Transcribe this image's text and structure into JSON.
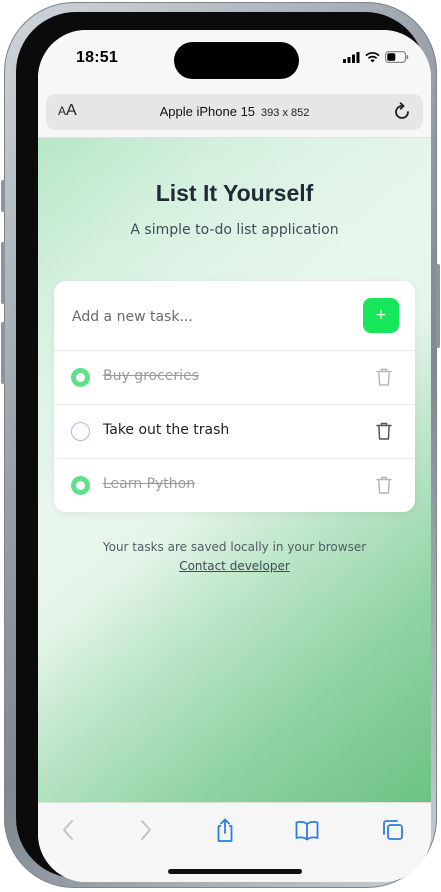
{
  "status_bar": {
    "time": "18:51"
  },
  "browser": {
    "text_size_label_small": "A",
    "text_size_label_large": "A",
    "device_name": "Apple iPhone 15",
    "viewport_size": "393 x 852"
  },
  "app": {
    "title": "List It Yourself",
    "subtitle": "A simple to-do list application",
    "input_placeholder": "Add a new task...",
    "add_button_label": "+",
    "tasks": [
      {
        "label": "Buy groceries",
        "completed": true
      },
      {
        "label": "Take out the trash",
        "completed": false
      },
      {
        "label": "Learn Python",
        "completed": true
      }
    ],
    "footer_note": "Your tasks are saved locally in your browser",
    "footer_link": "Contact developer"
  },
  "colors": {
    "accent_green": "#16e65a",
    "check_done": "#5fe08a",
    "check_todo_border": "#c9a6f2",
    "browser_blue": "#2a7de1"
  },
  "icons": {
    "status": [
      "signal-icon",
      "wifi-icon",
      "battery-icon"
    ],
    "browser_toolbar": [
      "back-icon",
      "forward-icon",
      "share-icon",
      "bookmarks-icon",
      "tabs-icon"
    ],
    "task_delete": "trash-icon",
    "reload": "reload-icon"
  }
}
